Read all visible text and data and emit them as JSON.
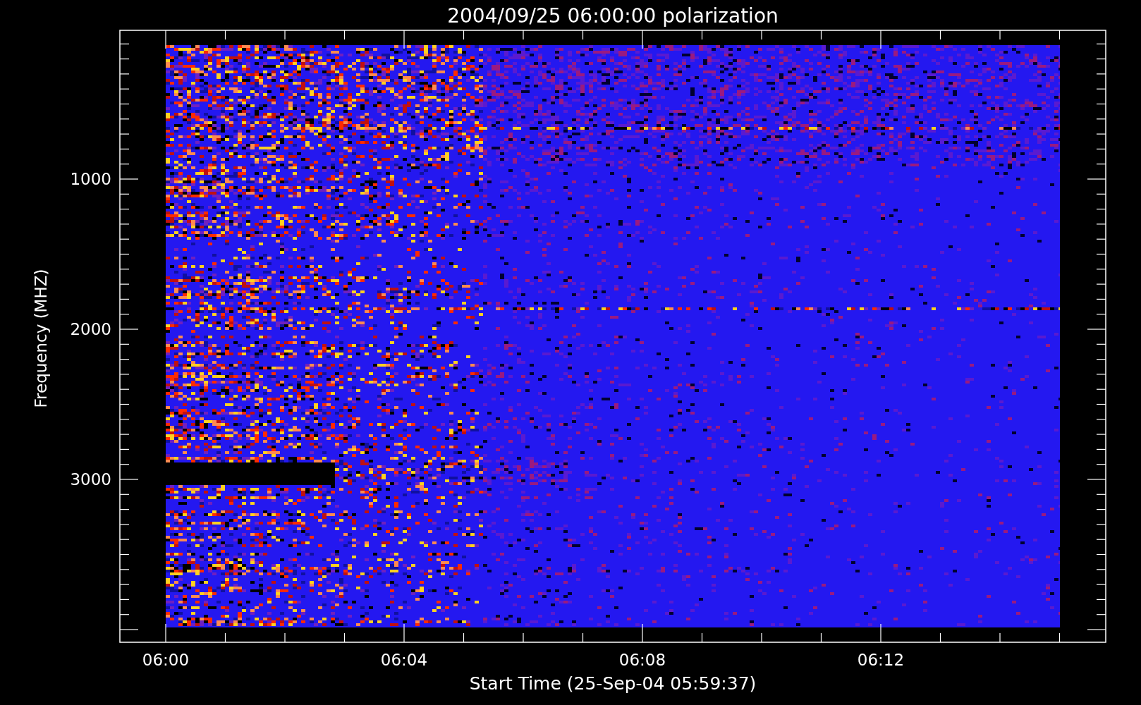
{
  "plot": {
    "title": "2004/09/25 06:00:00 polarization",
    "y_axis": {
      "title": "Frequency (MHZ)",
      "ticks": [
        "1000",
        "2000",
        "3000"
      ]
    },
    "x_axis": {
      "title": "Start Time (25-Sep-04 05:59:37)",
      "ticks": [
        "06:00",
        "06:04",
        "06:08",
        "06:12"
      ]
    }
  }
}
